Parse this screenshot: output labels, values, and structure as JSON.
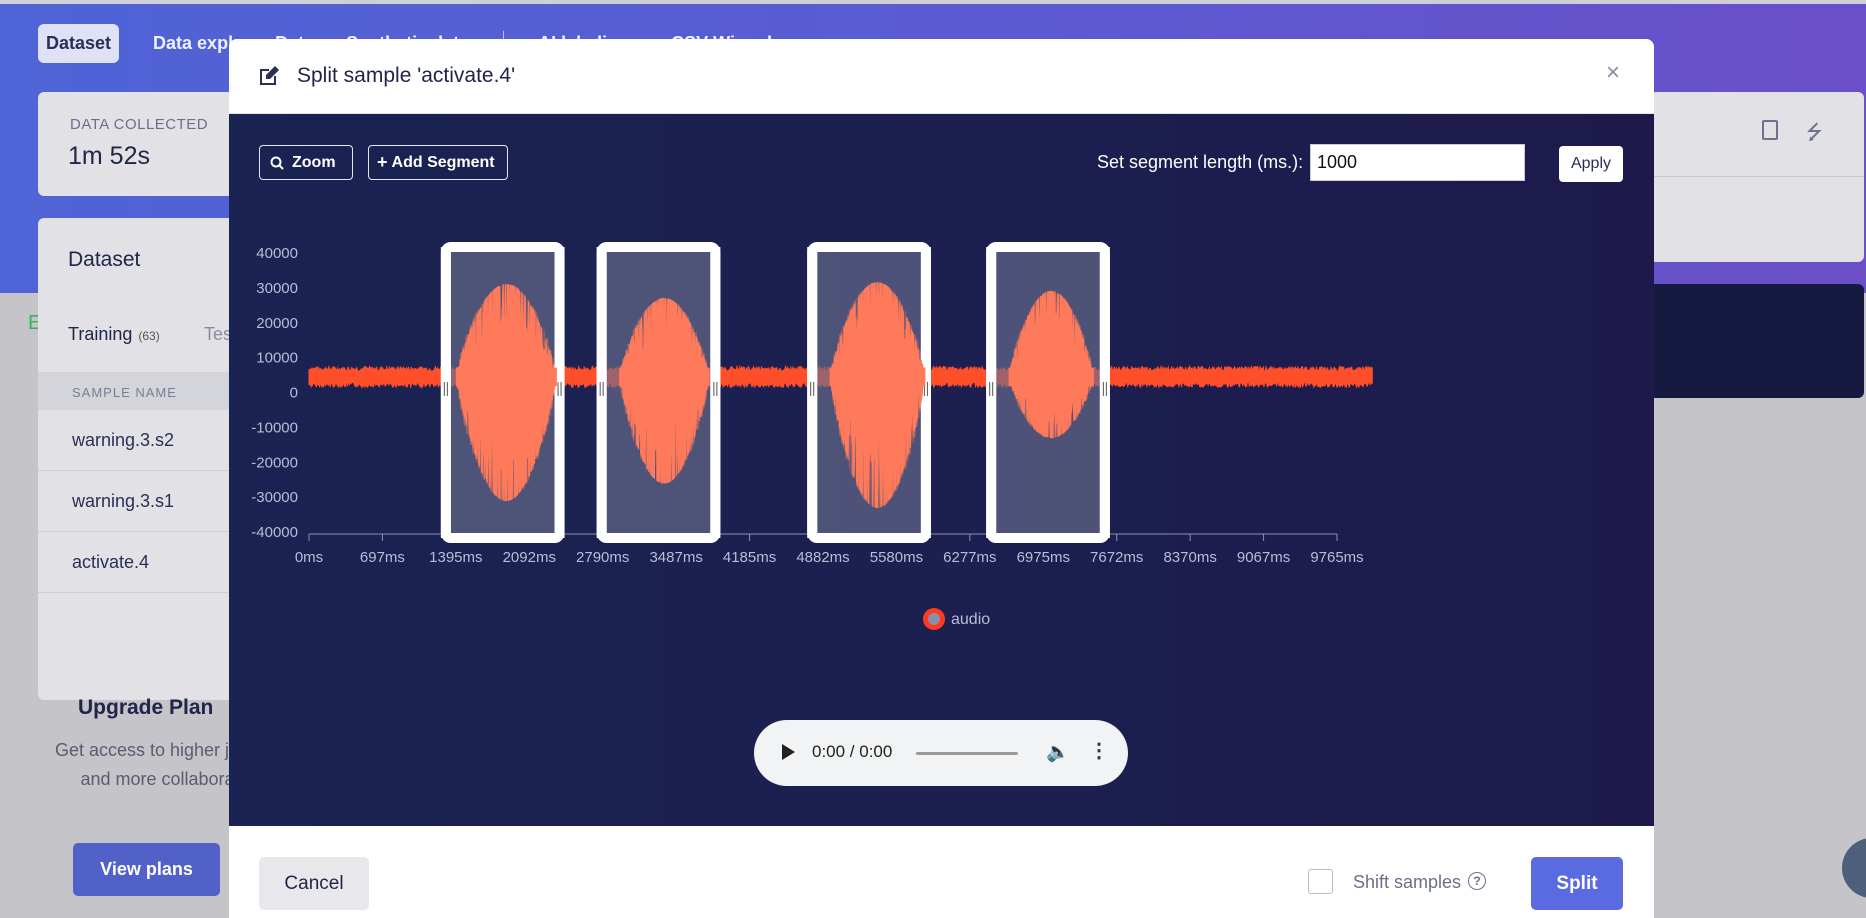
{
  "nav": {
    "tabs": [
      {
        "label": "Dataset",
        "active": true
      },
      {
        "label": "Data expl",
        "active": false
      },
      {
        "label": "Dat",
        "active": false
      },
      {
        "label": "Synthetic data",
        "active": false
      },
      {
        "label": "AI labeling",
        "active": false
      },
      {
        "label": "CSV Wizard",
        "active": false
      }
    ]
  },
  "summary": {
    "label": "DATA COLLECTED",
    "value": "1m 52s"
  },
  "dataset": {
    "title": "Dataset",
    "tab_training": "Training",
    "tab_training_count": "(63)",
    "tab_test": "Tes",
    "column_header": "SAMPLE NAME",
    "samples": [
      "warning.3.s2",
      "warning.3.s1",
      "activate.4"
    ]
  },
  "upgrade": {
    "title": "Upgrade Plan",
    "description": "Get access to higher job limits and more collaborators.",
    "button": "View plans"
  },
  "modal": {
    "title": "Split sample 'activate.4'",
    "close": "×",
    "zoom_label": "Zoom",
    "add_segment_label": "Add Segment",
    "segment_length_label": "Set segment length (ms.):",
    "segment_length_value": "1000",
    "apply_label": "Apply",
    "audio": {
      "time": "0:00 / 0:00"
    },
    "cancel_label": "Cancel",
    "shift_label": "Shift samples",
    "shift_checked": false,
    "split_label": "Split"
  },
  "chart_data": {
    "type": "line",
    "series": [
      {
        "name": "audio",
        "color": "#ff4e2a"
      }
    ],
    "x_ticks": [
      "0ms",
      "697ms",
      "1395ms",
      "2092ms",
      "2790ms",
      "3487ms",
      "4185ms",
      "4882ms",
      "5580ms",
      "6277ms",
      "6975ms",
      "7672ms",
      "8370ms",
      "9067ms",
      "9765ms"
    ],
    "y_ticks": [
      "40000",
      "30000",
      "20000",
      "10000",
      "0",
      "-10000",
      "-20000",
      "-30000",
      "-40000"
    ],
    "ylim": [
      -40000,
      40000
    ],
    "xlim": [
      0,
      10100
    ],
    "baseline": 4500,
    "bursts": [
      {
        "start": 1400,
        "end": 2350,
        "max": 31000,
        "min": -31000
      },
      {
        "start": 2950,
        "end": 3800,
        "max": 27000,
        "min": -26000
      },
      {
        "start": 4950,
        "end": 5850,
        "max": 31500,
        "min": -33000
      },
      {
        "start": 6650,
        "end": 7450,
        "max": 29000,
        "min": -13000
      }
    ],
    "segments": [
      {
        "start": 1300,
        "end": 2380
      },
      {
        "start": 2780,
        "end": 3860
      },
      {
        "start": 4780,
        "end": 5860
      },
      {
        "start": 6480,
        "end": 7560
      }
    ],
    "segment_color": "#6a6f8e",
    "burst_color": "#ff7a5a"
  }
}
